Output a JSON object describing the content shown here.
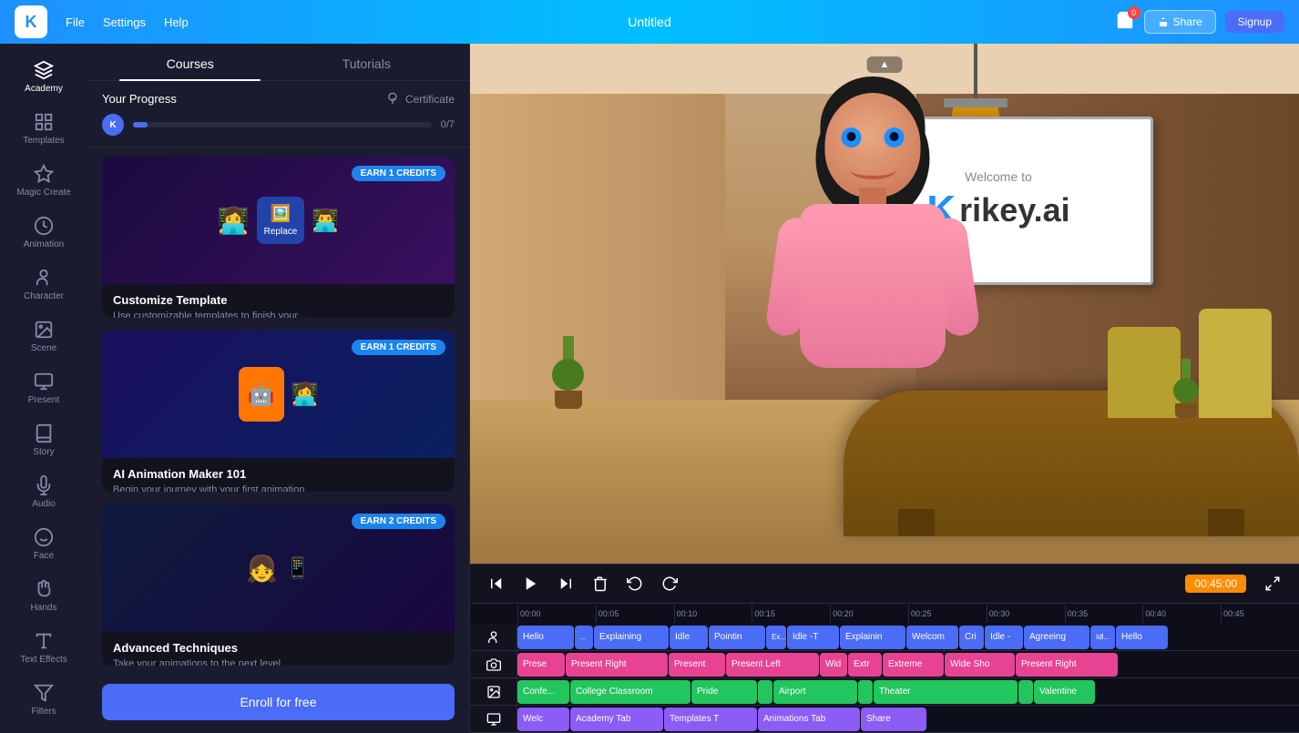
{
  "app": {
    "title": "Untitled",
    "logo": "K"
  },
  "nav": {
    "file": "File",
    "settings": "Settings",
    "help": "Help",
    "cart_count": "0",
    "share": "Share",
    "signup": "Signup"
  },
  "sidebar": {
    "items": [
      {
        "id": "academy",
        "label": "Academy",
        "icon": "academy"
      },
      {
        "id": "templates",
        "label": "Templates",
        "icon": "templates"
      },
      {
        "id": "magic-create",
        "label": "Magic Create",
        "icon": "magic"
      },
      {
        "id": "animation",
        "label": "Animation",
        "icon": "animation"
      },
      {
        "id": "character",
        "label": "Character",
        "icon": "character"
      },
      {
        "id": "scene",
        "label": "Scene",
        "icon": "scene"
      },
      {
        "id": "present",
        "label": "Present",
        "icon": "present"
      },
      {
        "id": "story",
        "label": "Story",
        "icon": "story"
      },
      {
        "id": "audio",
        "label": "Audio",
        "icon": "audio"
      },
      {
        "id": "face",
        "label": "Face",
        "icon": "face"
      },
      {
        "id": "hands",
        "label": "Hands",
        "icon": "hands"
      },
      {
        "id": "text-effects",
        "label": "Text Effects",
        "icon": "text"
      },
      {
        "id": "filters",
        "label": "Filters",
        "icon": "filters"
      }
    ]
  },
  "academy": {
    "tabs": [
      "Courses",
      "Tutorials"
    ],
    "active_tab": "Courses",
    "progress": {
      "label": "Your Progress",
      "certificate_label": "Certificate",
      "count": "0/7",
      "fill_percent": 5
    },
    "cards": [
      {
        "id": "card1",
        "earn_badge": "EARN 1 CREDITS",
        "title": "Customize Template",
        "desc": "Use customizable templates to finish your ...",
        "img_type": "card-img-1"
      },
      {
        "id": "card2",
        "earn_badge": "EARN 1 CREDITS",
        "title": "AI Animation Maker 101",
        "desc": "Begin your journey with your first animation",
        "img_type": "card-img-2"
      },
      {
        "id": "card3",
        "earn_badge": "EARN 2 CREDITS",
        "title": "Advanced Techniques",
        "desc": "Take your animations to the next level",
        "img_type": "card-img-3"
      }
    ],
    "enroll_btn": "Enroll for free"
  },
  "video": {
    "whiteboard_welcome": "Welcome to",
    "whiteboard_logo": "Krikey.ai",
    "floating_label": "▲"
  },
  "timeline": {
    "current_time": "00:45:00",
    "ruler_marks": [
      "00:00",
      "00:05",
      "00:10",
      "00:15",
      "00:20",
      "00:25",
      "00:30",
      "00:35",
      "00:40",
      "00:45"
    ],
    "tracks": [
      {
        "icon": "person",
        "segments": [
          {
            "label": "Hello",
            "color": "seg-blue",
            "width": 60
          },
          {
            "label": "...",
            "color": "seg-blue",
            "width": 18
          },
          {
            "label": "Explaining",
            "color": "seg-blue",
            "width": 80
          },
          {
            "label": "Idle",
            "color": "seg-blue",
            "width": 40
          },
          {
            "label": "Pointin",
            "color": "seg-blue",
            "width": 60
          },
          {
            "label": "Ex...",
            "color": "seg-blue",
            "width": 20
          },
          {
            "label": "Idle -T",
            "color": "seg-blue",
            "width": 55
          },
          {
            "label": "Explainin",
            "color": "seg-blue",
            "width": 70
          },
          {
            "label": "Welcom",
            "color": "seg-blue",
            "width": 55
          },
          {
            "label": "Cri",
            "color": "seg-blue",
            "width": 25
          },
          {
            "label": "Idle -",
            "color": "seg-blue",
            "width": 40
          },
          {
            "label": "Agreeing",
            "color": "seg-blue",
            "width": 70
          },
          {
            "label": "Idl...",
            "color": "seg-blue",
            "width": 25
          },
          {
            "label": "Hello",
            "color": "seg-blue",
            "width": 55
          }
        ]
      },
      {
        "icon": "camera",
        "segments": [
          {
            "label": "Prese",
            "color": "seg-pink",
            "width": 50
          },
          {
            "label": "Present Right",
            "color": "seg-pink",
            "width": 110
          },
          {
            "label": "Present",
            "color": "seg-pink",
            "width": 60
          },
          {
            "label": "Present Left",
            "color": "seg-pink",
            "width": 100
          },
          {
            "label": "Wid",
            "color": "seg-pink",
            "width": 28
          },
          {
            "label": "Extr",
            "color": "seg-pink",
            "width": 35
          },
          {
            "label": "Extreme",
            "color": "seg-pink",
            "width": 65
          },
          {
            "label": "Wide Sho",
            "color": "seg-pink",
            "width": 75
          },
          {
            "label": "Present Right",
            "color": "seg-pink",
            "width": 110
          }
        ]
      },
      {
        "icon": "image",
        "segments": [
          {
            "label": "Confe...",
            "color": "seg-green",
            "width": 55
          },
          {
            "label": "College Classroom",
            "color": "seg-green",
            "width": 130
          },
          {
            "label": "Pride",
            "color": "seg-green",
            "width": 70
          },
          {
            "label": "",
            "color": "seg-green",
            "width": 15
          },
          {
            "label": "Airport",
            "color": "seg-green",
            "width": 90
          },
          {
            "label": "",
            "color": "seg-green",
            "width": 14
          },
          {
            "label": "Theater",
            "color": "seg-green",
            "width": 155
          },
          {
            "label": "",
            "color": "seg-green",
            "width": 14
          },
          {
            "label": "Valentine",
            "color": "seg-green",
            "width": 65
          }
        ]
      },
      {
        "icon": "monitor",
        "segments": [
          {
            "label": "Welc",
            "color": "seg-purple",
            "width": 55
          },
          {
            "label": "Academy Tab",
            "color": "seg-purple",
            "width": 100
          },
          {
            "label": "Templates T",
            "color": "seg-purple",
            "width": 100
          },
          {
            "label": "Animations Tab",
            "color": "seg-purple",
            "width": 110
          },
          {
            "label": "Share",
            "color": "seg-purple",
            "width": 70
          }
        ]
      }
    ]
  }
}
